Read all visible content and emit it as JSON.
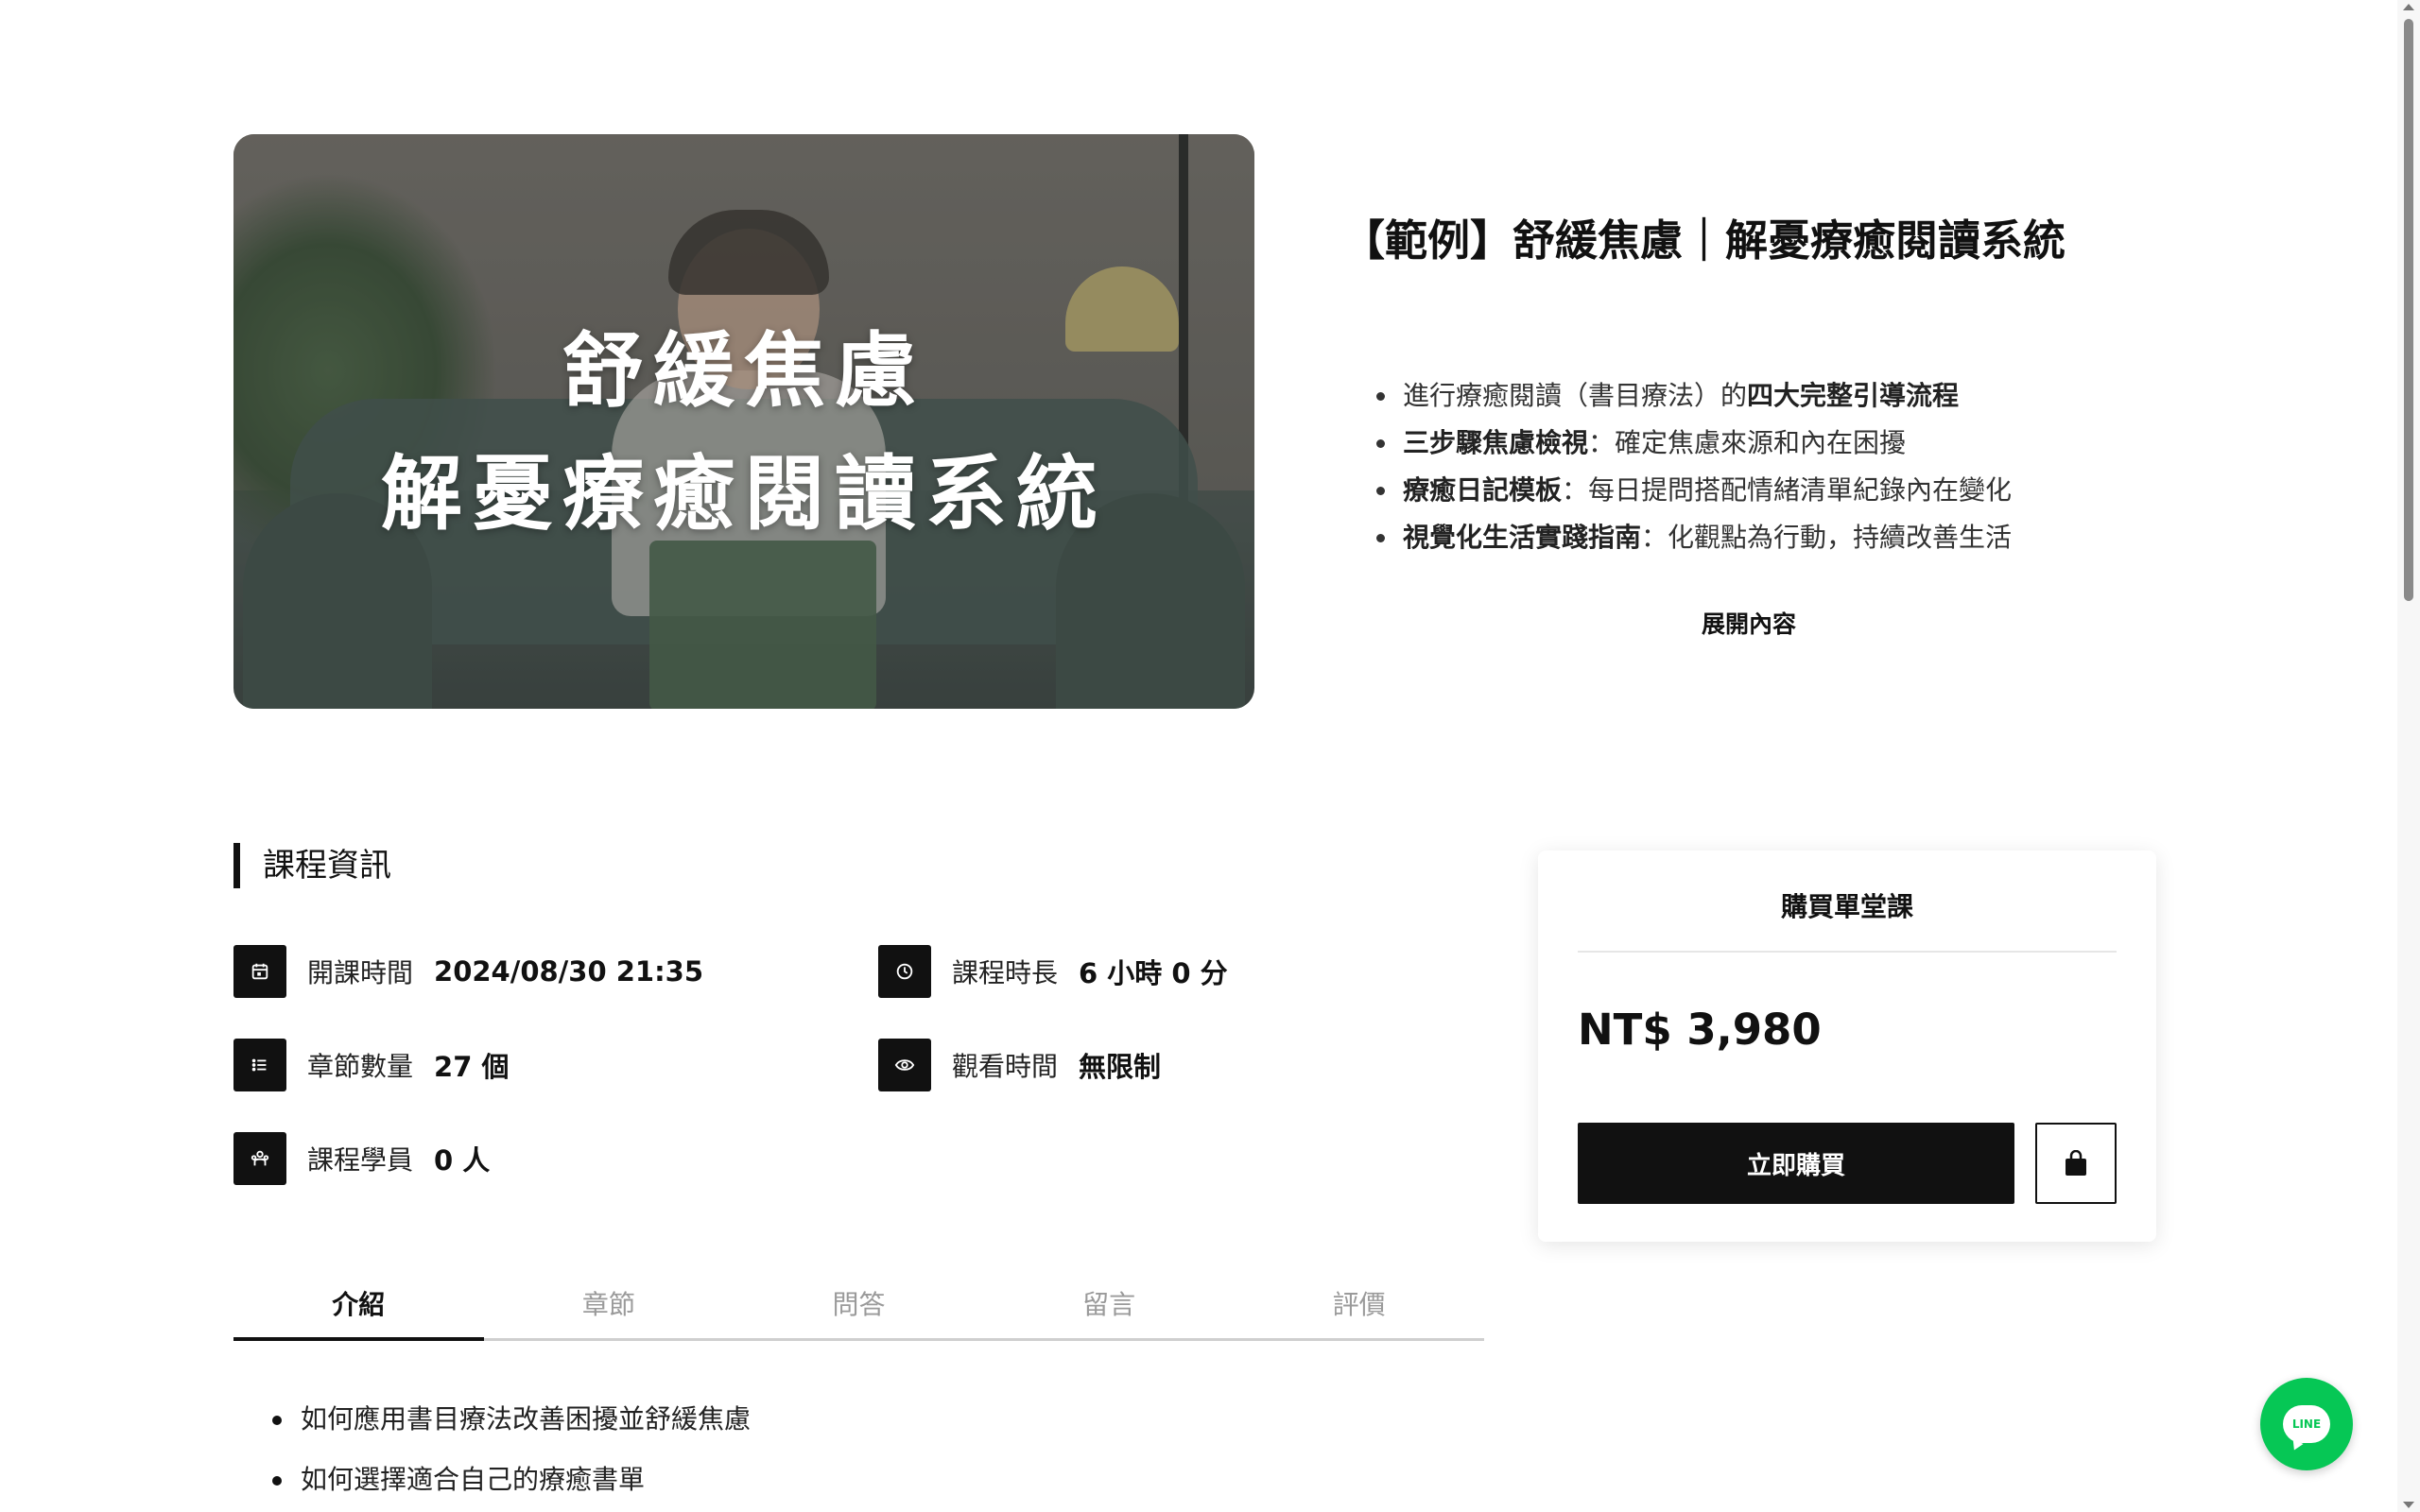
{
  "hero": {
    "image_title_line1": "舒緩焦慮",
    "image_title_line2": "解憂療癒閱讀系統"
  },
  "course": {
    "title": "【範例】舒緩焦慮｜解憂療癒閱讀系統",
    "summary": [
      {
        "bold_prefix": "",
        "text": "進行療癒閱讀（書目療法）的",
        "bold_suffix": "四大完整引導流程"
      },
      {
        "bold_prefix": "三步驟焦慮檢視",
        "text": "：確定焦慮來源和內在困擾",
        "bold_suffix": ""
      },
      {
        "bold_prefix": "療癒日記模板",
        "text": "：每日提問搭配情緒清單紀錄內在變化",
        "bold_suffix": ""
      },
      {
        "bold_prefix": "視覺化生活實踐指南",
        "text": "：化觀點為行動，持續改善生活",
        "bold_suffix": ""
      }
    ],
    "expand_label": "展開內容"
  },
  "info": {
    "heading": "課程資訊",
    "start_label": "開課時間",
    "start_value": "2024/08/30 21:35",
    "duration_label": "課程時長",
    "duration_value": "6 小時 0 分",
    "chapters_label": "章節數量",
    "chapters_value": "27 個",
    "watch_label": "觀看時間",
    "watch_value": "無限制",
    "students_label": "課程學員",
    "students_value": "0 人"
  },
  "purchase": {
    "title": "購買單堂課",
    "price": "NT$ 3,980",
    "buy_label": "立即購買"
  },
  "tabs": [
    "介紹",
    "章節",
    "問答",
    "留言",
    "評價"
  ],
  "active_tab": 0,
  "intro": [
    "如何應用書目療法改善困擾並舒緩焦慮",
    "如何選擇適合自己的療癒書單"
  ],
  "line_button": {
    "label": "LINE"
  },
  "colors": {
    "line_green": "#06c755",
    "primary": "#111111"
  }
}
